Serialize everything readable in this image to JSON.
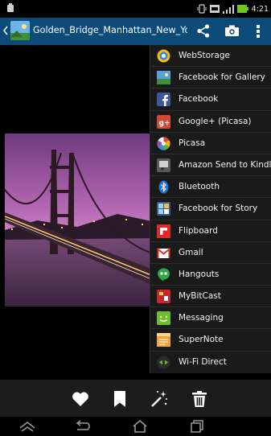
{
  "status_bar": {
    "time": "4:21"
  },
  "action_bar": {
    "title": "Golden_Bridge_Manhattan_New_York_N..."
  },
  "share_menu": {
    "items": [
      {
        "label": "WebStorage",
        "icon": "webstorage-icon"
      },
      {
        "label": "Facebook for Gallery",
        "icon": "facebook-gallery-icon"
      },
      {
        "label": "Facebook",
        "icon": "facebook-icon"
      },
      {
        "label": "Google+ (Picasa)",
        "icon": "google-plus-icon"
      },
      {
        "label": "Picasa",
        "icon": "picasa-icon"
      },
      {
        "label": "Amazon Send to Kindle",
        "icon": "kindle-icon"
      },
      {
        "label": "Bluetooth",
        "icon": "bluetooth-icon"
      },
      {
        "label": "Facebook for Story",
        "icon": "facebook-story-icon"
      },
      {
        "label": "Flipboard",
        "icon": "flipboard-icon"
      },
      {
        "label": "Gmail",
        "icon": "gmail-icon"
      },
      {
        "label": "Hangouts",
        "icon": "hangouts-icon"
      },
      {
        "label": "MyBitCast",
        "icon": "mybitcast-icon"
      },
      {
        "label": "Messaging",
        "icon": "messaging-icon"
      },
      {
        "label": "SuperNote",
        "icon": "supernote-icon"
      },
      {
        "label": "Wi-Fi Direct",
        "icon": "wifi-direct-icon"
      }
    ]
  },
  "toolbar": {
    "buttons": [
      "heart-icon",
      "bookmark-icon",
      "magic-wand-icon",
      "trash-icon"
    ]
  },
  "nav_bar": {
    "buttons": [
      "recent-apps-icon",
      "back-icon",
      "home-icon",
      "overview-icon"
    ]
  },
  "colors": {
    "action_bar": "#0c4a78",
    "menu_background": "#1a1a1a",
    "toolbar": "#1c1c1c"
  }
}
